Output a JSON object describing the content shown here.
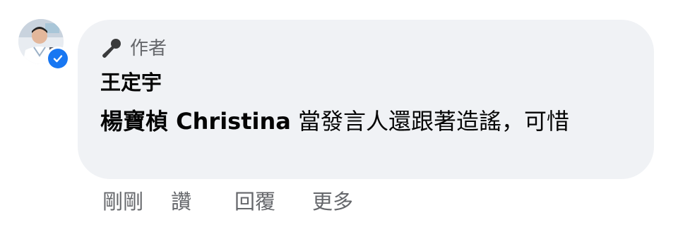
{
  "comment": {
    "author_badge_label": "作者",
    "author_badge_icon": "microphone-icon",
    "author_name": "王定宇",
    "tagged_name": "楊寶楨 Christina",
    "text_rest": " 當發言人還跟著造謠，可惜",
    "timestamp": "剛剛",
    "like_label": "讚",
    "reply_label": "回覆",
    "more_label": "更多",
    "verified_icon": "verified-check-icon"
  },
  "colors": {
    "bubble_bg": "#f0f2f5",
    "text": "#050505",
    "secondary_text": "#65676b",
    "verified_blue": "#1877f2"
  }
}
